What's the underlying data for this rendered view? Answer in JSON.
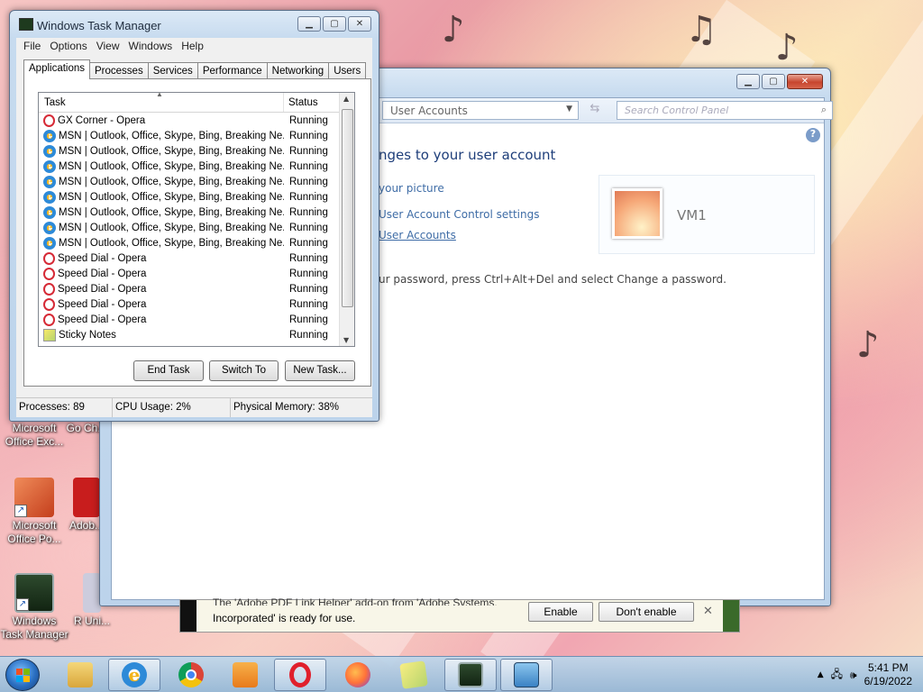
{
  "desktop": {
    "icons": [
      {
        "label": "Microsoft Office Exc...",
        "icon": "excel-shortcut-icon"
      },
      {
        "label": "Go Ch...",
        "icon": "chrome-shortcut-icon"
      },
      {
        "label": "Microsoft Office Po...",
        "icon": "powerpoint-shortcut-icon"
      },
      {
        "label": "Adob...",
        "icon": "adobe-shortcut-icon"
      },
      {
        "label": "Windows Task Manager",
        "icon": "task-manager-shortcut-icon"
      },
      {
        "label": "R Uni...",
        "icon": "uninstall-shortcut-icon"
      }
    ]
  },
  "control_panel": {
    "breadcrumb": "User Accounts",
    "search_placeholder": "Search Control Panel",
    "heading": "nges to your user account",
    "links": [
      "your picture",
      "User Account Control settings",
      "User Accounts"
    ],
    "password_hint": "ur password, press Ctrl+Alt+Del and select Change a password.",
    "account_name": "VM1"
  },
  "notification": {
    "message_line1": "The 'Adobe PDF Link Helper' add-on from 'Adobe Systems,",
    "message_line2": "Incorporated' is ready for use.",
    "enable": "Enable",
    "dont_enable": "Don't enable"
  },
  "task_manager": {
    "title": "Windows Task Manager",
    "menu": [
      "File",
      "Options",
      "View",
      "Windows",
      "Help"
    ],
    "tabs": [
      "Applications",
      "Processes",
      "Services",
      "Performance",
      "Networking",
      "Users"
    ],
    "active_tab": "Applications",
    "columns": {
      "task": "Task",
      "status": "Status"
    },
    "rows": [
      {
        "task": "GX Corner - Opera",
        "status": "Running",
        "icon": "opera-icon"
      },
      {
        "task": "MSN | Outlook, Office, Skype, Bing, Breaking Ne...",
        "status": "Running",
        "icon": "ie-icon"
      },
      {
        "task": "MSN | Outlook, Office, Skype, Bing, Breaking Ne...",
        "status": "Running",
        "icon": "ie-icon"
      },
      {
        "task": "MSN | Outlook, Office, Skype, Bing, Breaking Ne...",
        "status": "Running",
        "icon": "ie-icon"
      },
      {
        "task": "MSN | Outlook, Office, Skype, Bing, Breaking Ne...",
        "status": "Running",
        "icon": "ie-icon"
      },
      {
        "task": "MSN | Outlook, Office, Skype, Bing, Breaking Ne...",
        "status": "Running",
        "icon": "ie-icon"
      },
      {
        "task": "MSN | Outlook, Office, Skype, Bing, Breaking Ne...",
        "status": "Running",
        "icon": "ie-icon"
      },
      {
        "task": "MSN | Outlook, Office, Skype, Bing, Breaking Ne...",
        "status": "Running",
        "icon": "ie-icon"
      },
      {
        "task": "MSN | Outlook, Office, Skype, Bing, Breaking Ne...",
        "status": "Running",
        "icon": "ie-icon"
      },
      {
        "task": "Speed Dial - Opera",
        "status": "Running",
        "icon": "opera-icon"
      },
      {
        "task": "Speed Dial - Opera",
        "status": "Running",
        "icon": "opera-icon"
      },
      {
        "task": "Speed Dial - Opera",
        "status": "Running",
        "icon": "opera-icon"
      },
      {
        "task": "Speed Dial - Opera",
        "status": "Running",
        "icon": "opera-icon"
      },
      {
        "task": "Speed Dial - Opera",
        "status": "Running",
        "icon": "opera-icon"
      },
      {
        "task": "Sticky Notes",
        "status": "Running",
        "icon": "sticky-notes-icon"
      }
    ],
    "buttons": {
      "end_task": "End Task",
      "switch_to": "Switch To",
      "new_task": "New Task..."
    },
    "status_bar": {
      "processes": "Processes: 89",
      "cpu": "CPU Usage: 2%",
      "memory": "Physical Memory: 38%"
    }
  },
  "taskbar": {
    "items": [
      "file-explorer-icon",
      "internet-explorer-icon",
      "chrome-icon",
      "media-player-icon",
      "opera-icon",
      "firefox-icon",
      "sticky-notes-icon",
      "task-manager-icon",
      "control-panel-icon"
    ],
    "clock_time": "5:41 PM",
    "clock_date": "6/19/2022"
  }
}
